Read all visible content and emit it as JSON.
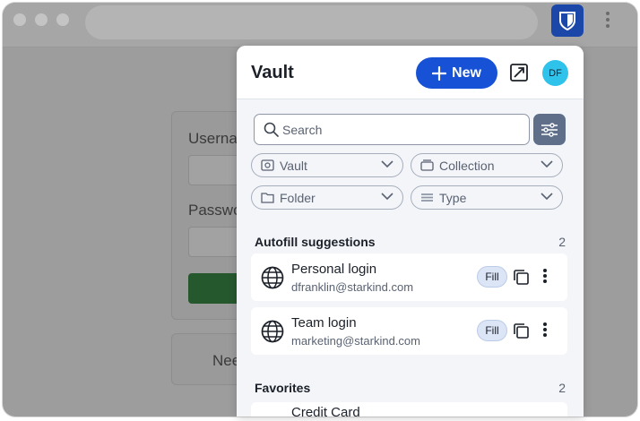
{
  "page": {
    "labels": {
      "username": "Userna",
      "password": "Passwo",
      "need": "Nee"
    }
  },
  "popup": {
    "title": "Vault",
    "new_label": "New",
    "avatar_initials": "DF",
    "search": {
      "placeholder": "Search"
    },
    "filters": [
      {
        "label": "Vault",
        "icon": "vault-icon"
      },
      {
        "label": "Collection",
        "icon": "collection-icon"
      },
      {
        "label": "Folder",
        "icon": "folder-icon"
      },
      {
        "label": "Type",
        "icon": "type-icon"
      }
    ],
    "autofill": {
      "heading": "Autofill suggestions",
      "count": "2",
      "items": [
        {
          "name": "Personal login",
          "username": "dfranklin@starkind.com",
          "fill_label": "Fill"
        },
        {
          "name": "Team login",
          "username": "marketing@starkind.com",
          "fill_label": "Fill"
        }
      ]
    },
    "favorites": {
      "heading": "Favorites",
      "count": "2",
      "items": [
        {
          "name": "Credit Card"
        }
      ]
    }
  },
  "colors": {
    "accent": "#1752d6",
    "extension_icon": "#1a47a8",
    "avatar": "#2fc2eb",
    "filter_button": "#5f6f8a"
  }
}
